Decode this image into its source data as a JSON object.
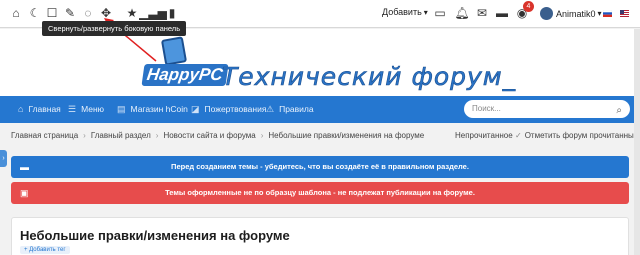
{
  "topbar": {
    "icons_left": [
      "home-icon",
      "moon-icon",
      "square-icon",
      "brush-icon",
      "spinner-icon",
      "arrows-icon",
      "star-icon",
      "signal-icon",
      "bookmark-icon"
    ],
    "add_label": "Добавить",
    "notification_count": "4",
    "username": "Animatik0",
    "icons_right": [
      "card-icon",
      "bell-icon",
      "envelope-icon",
      "mail-icon",
      "eye-icon"
    ]
  },
  "tooltip": {
    "text": "Свернуть/развернуть боковую панель"
  },
  "header": {
    "brand": "HappyPC",
    "title": "Технический форум_"
  },
  "nav": {
    "items": [
      {
        "label": "Главная",
        "icon": "home-icon"
      },
      {
        "label": "Меню",
        "icon": "menu-icon"
      },
      {
        "label": "Магазин hCoin",
        "icon": "shop-icon"
      },
      {
        "label": "Пожертвования",
        "icon": "donate-icon"
      },
      {
        "label": "Правила",
        "icon": "warning-icon"
      }
    ],
    "search_placeholder": "Поиск..."
  },
  "breadcrumb": {
    "items": [
      "Главная страница",
      "Главный раздел",
      "Новости сайта и форума",
      "Небольшие правки/изменения на форуме"
    ],
    "unread_label": "Непрочитанное",
    "mark_read_label": "Отметить форум прочитанным"
  },
  "notices": {
    "info": "Перед созданием темы - убедитесь, что вы создаёте её в правильном разделе.",
    "warning": "Темы оформленные не по образцу шаблона - не подлежат публикации на форуме."
  },
  "thread": {
    "title": "Небольшие правки/изменения на форуме",
    "add_tag_label": "+ Добавить тег"
  },
  "colors": {
    "accent": "#2577d0",
    "warning": "#e74c4c",
    "badge": "#d9342b"
  }
}
